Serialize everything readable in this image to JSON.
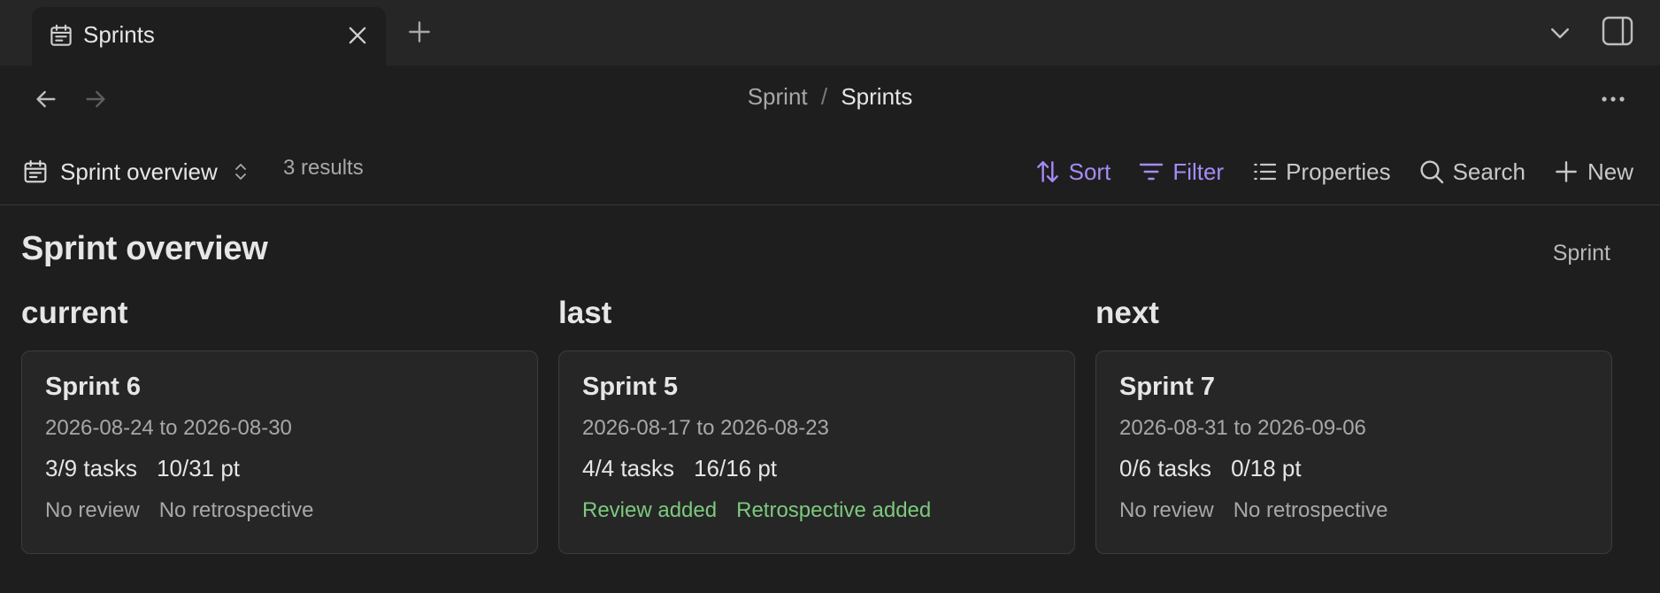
{
  "tab": {
    "label": "Sprints",
    "icon": "calendar-icon"
  },
  "breadcrumb": {
    "parent": "Sprint",
    "separator": "/",
    "current": "Sprints"
  },
  "toolbar": {
    "view_name": "Sprint overview",
    "results": "3 results",
    "sort_label": "Sort",
    "filter_label": "Filter",
    "properties_label": "Properties",
    "search_label": "Search",
    "new_label": "New"
  },
  "view": {
    "title": "Sprint overview",
    "group_by": "Sprint"
  },
  "columns": [
    {
      "label": "current",
      "card": {
        "title": "Sprint 6",
        "dates": "2026-08-24 to 2026-08-30",
        "tasks": "3/9 tasks",
        "points": "10/31 pt",
        "review": "No review",
        "retro": "No retrospective"
      }
    },
    {
      "label": "last",
      "card": {
        "title": "Sprint 5",
        "dates": "2026-08-17 to 2026-08-23",
        "tasks": "4/4 tasks",
        "points": "16/16 pt",
        "review": "Review added",
        "retro": "Retrospective added"
      }
    },
    {
      "label": "next",
      "card": {
        "title": "Sprint 7",
        "dates": "2026-08-31 to 2026-09-06",
        "tasks": "0/6 tasks",
        "points": "0/18 pt",
        "review": "No review",
        "retro": "No retrospective"
      }
    }
  ],
  "colors": {
    "background": "#1e1e1e",
    "accent": "#a68bf6",
    "added": "#7cc97e",
    "card": "#262626"
  }
}
